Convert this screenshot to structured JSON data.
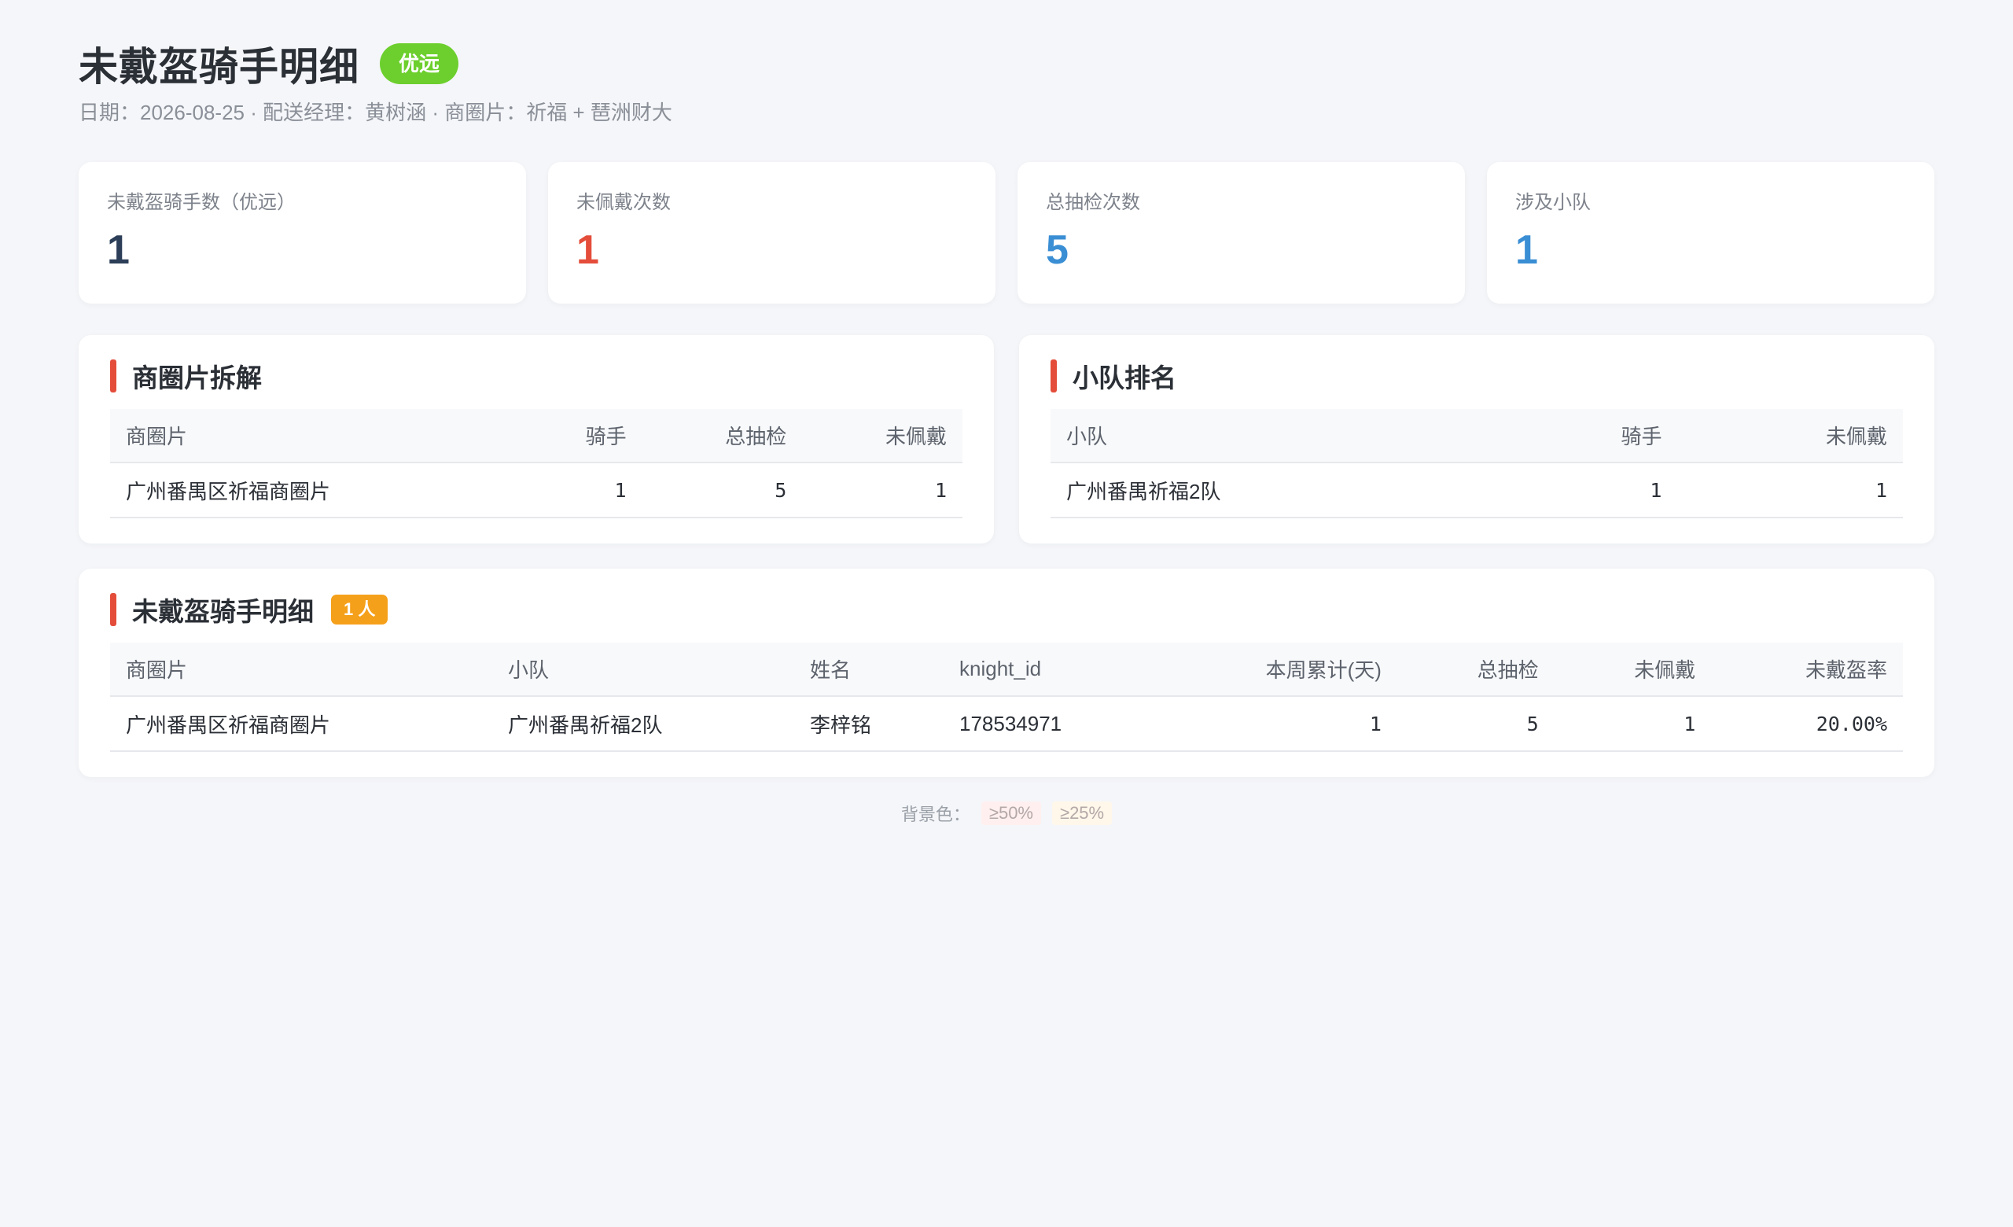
{
  "header": {
    "title": "未戴盔骑手明细",
    "brand": "优远",
    "subtitle": "日期：2026-08-25 · 配送经理：黄树涵 · 商圈片：祈福 + 琶洲财大"
  },
  "kpis": [
    {
      "label": "未戴盔骑手数（优远）",
      "value": "1",
      "color": "#2c3e58"
    },
    {
      "label": "未佩戴次数",
      "value": "1",
      "color": "#e44d3a"
    },
    {
      "label": "总抽检次数",
      "value": "5",
      "color": "#3a8ed4"
    },
    {
      "label": "涉及小队",
      "value": "1",
      "color": "#3a8ed4"
    }
  ],
  "district_panel": {
    "title": "商圈片拆解",
    "columns": [
      "商圈片",
      "骑手",
      "总抽检",
      "未佩戴"
    ],
    "rows": [
      [
        "广州番禺区祈福商圈片",
        "1",
        "5",
        "1"
      ]
    ]
  },
  "team_panel": {
    "title": "小队排名",
    "columns": [
      "小队",
      "骑手",
      "未佩戴"
    ],
    "rows": [
      [
        "广州番禺祈福2队",
        "1",
        "1"
      ]
    ]
  },
  "detail_panel": {
    "title": "未戴盔骑手明细",
    "count_badge": "1 人",
    "columns": [
      "商圈片",
      "小队",
      "姓名",
      "knight_id",
      "本周累计(天)",
      "总抽检",
      "未佩戴",
      "未戴盔率"
    ],
    "rows": [
      [
        "广州番禺区祈福商圈片",
        "广州番禺祈福2队",
        "李梓铭",
        "178534971",
        "1",
        "5",
        "1",
        "20.00%"
      ]
    ]
  },
  "legend": {
    "label": "背景色：",
    "high": "≥50%",
    "mid": "≥25%",
    "high_color": "#fff0ef",
    "mid_color": "#fff7ea"
  },
  "colors": {
    "accent": "#e44d3a",
    "brand_badge": "#6ccf2d",
    "count_badge": "#f5a01a"
  }
}
